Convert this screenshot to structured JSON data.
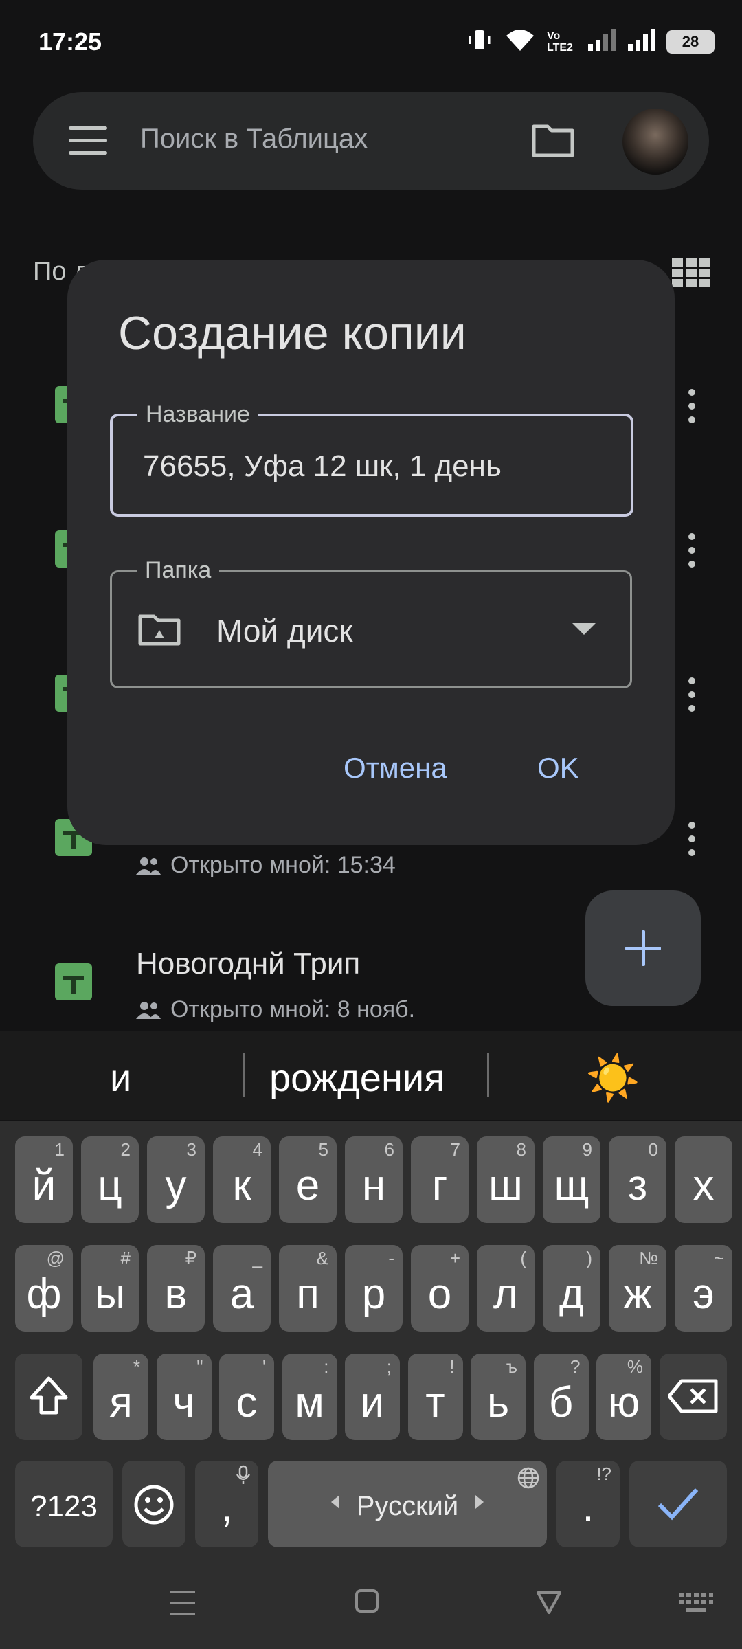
{
  "status_bar": {
    "time": "17:25",
    "battery": "28",
    "network": "Vo LTE2"
  },
  "search": {
    "placeholder": "Поиск в Таблицах"
  },
  "list": {
    "sort_label": "По д",
    "items": [
      {
        "title": "",
        "meta": "Открыто мной: 15:34"
      },
      {
        "title": "Новогоднй Трип",
        "meta": "Открыто мной: 8 нояб."
      }
    ]
  },
  "dialog": {
    "title": "Создание копии",
    "name_label": "Название",
    "name_value": "76655, Уфа 12 шк, 1 день",
    "folder_label": "Папка",
    "folder_value": "Мой диск",
    "cancel": "Отмена",
    "ok": "OK"
  },
  "suggestions": [
    "и",
    "рождения",
    "☀️"
  ],
  "keyboard": {
    "row1": [
      [
        "й",
        "1"
      ],
      [
        "ц",
        "2"
      ],
      [
        "у",
        "3"
      ],
      [
        "к",
        "4"
      ],
      [
        "е",
        "5"
      ],
      [
        "н",
        "6"
      ],
      [
        "г",
        "7"
      ],
      [
        "ш",
        "8"
      ],
      [
        "щ",
        "9"
      ],
      [
        "з",
        "0"
      ],
      [
        "х",
        ""
      ]
    ],
    "row2": [
      [
        "ф",
        "@"
      ],
      [
        "ы",
        "#"
      ],
      [
        "в",
        "₽"
      ],
      [
        "а",
        "_"
      ],
      [
        "п",
        "&"
      ],
      [
        "р",
        "-"
      ],
      [
        "о",
        "+"
      ],
      [
        "л",
        "("
      ],
      [
        "д",
        ")"
      ],
      [
        "ж",
        "№"
      ],
      [
        "э",
        "~"
      ]
    ],
    "row3": [
      [
        "я",
        "*"
      ],
      [
        "ч",
        "\""
      ],
      [
        "с",
        "'"
      ],
      [
        "м",
        ":"
      ],
      [
        "и",
        ";"
      ],
      [
        "т",
        "!"
      ],
      [
        "ь",
        "ъ"
      ],
      [
        "б",
        "?"
      ],
      [
        "ю",
        "%"
      ]
    ],
    "symbols_label": "?123",
    "comma": ",",
    "space_label": "Русский",
    "period": ".",
    "period_hint": "!?"
  }
}
